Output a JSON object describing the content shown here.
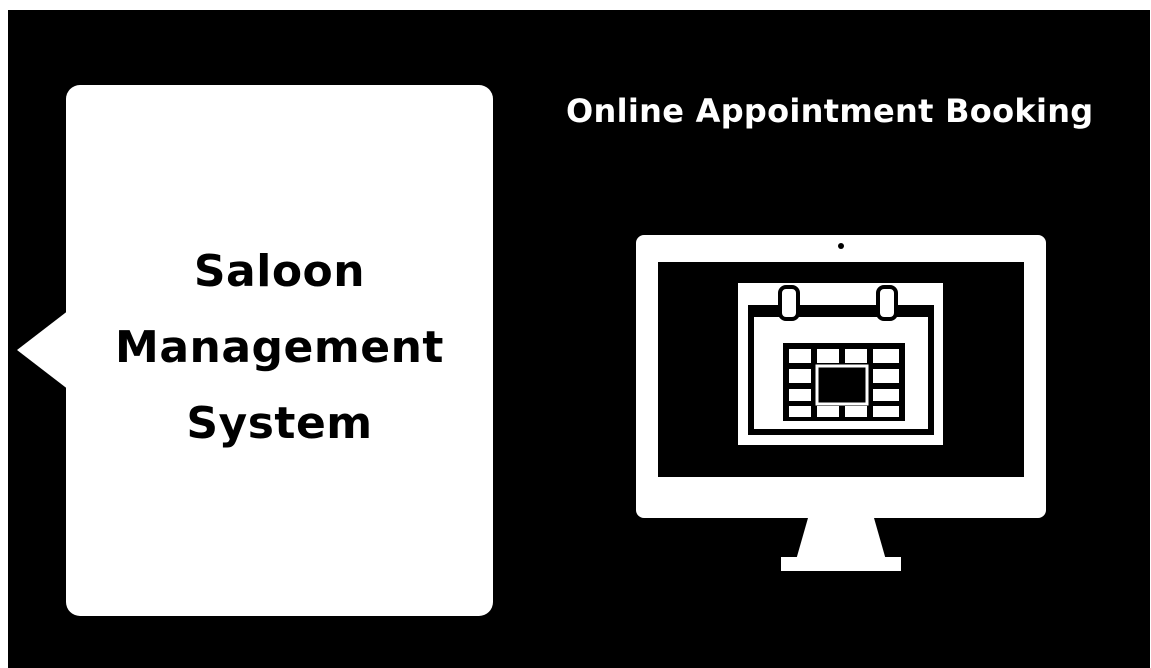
{
  "bubble": {
    "lines": [
      "Saloon",
      "Management",
      "System"
    ]
  },
  "headline": {
    "text": "Online Appointment Booking"
  },
  "illustration": {
    "icon": "computer-monitor-calendar-icon"
  },
  "colors": {
    "background": "#000000",
    "foreground": "#ffffff"
  }
}
